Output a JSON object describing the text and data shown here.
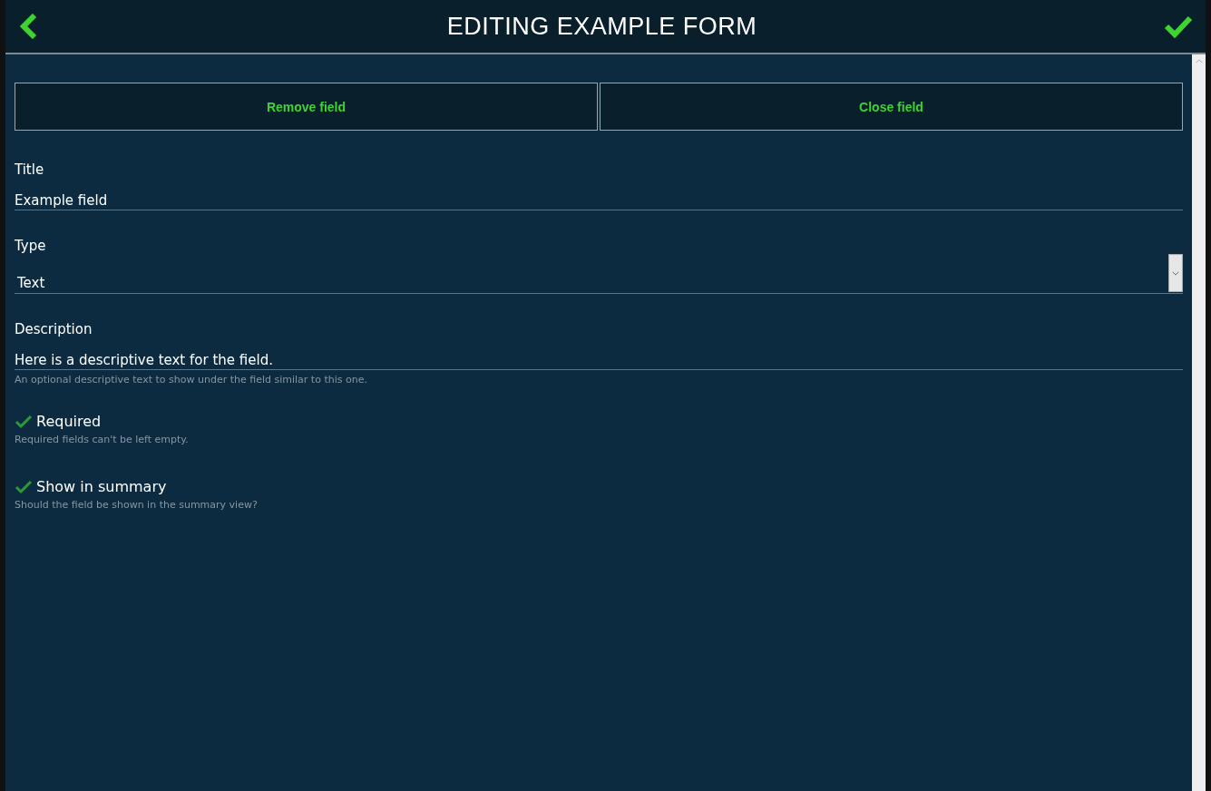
{
  "window": {
    "title": "EDITING EXAMPLE FORM"
  },
  "buttons": [
    "Remove field",
    "Close field"
  ],
  "fields": [
    {
      "kind": "text",
      "label": "Title",
      "value": "Example field"
    },
    {
      "kind": "select",
      "label": "Type",
      "value": "Text"
    },
    {
      "kind": "text",
      "label": "Description",
      "value": "Here is a descriptive text for the field.",
      "hint": "An optional descriptive text to show under the field similar to this one."
    }
  ],
  "options": [
    {
      "label": "Required",
      "checked": true,
      "hint": "Required fields can't be left empty."
    },
    {
      "label": "Show in summary",
      "checked": true,
      "hint": "Should the field be shown in the summary view?"
    }
  ]
}
